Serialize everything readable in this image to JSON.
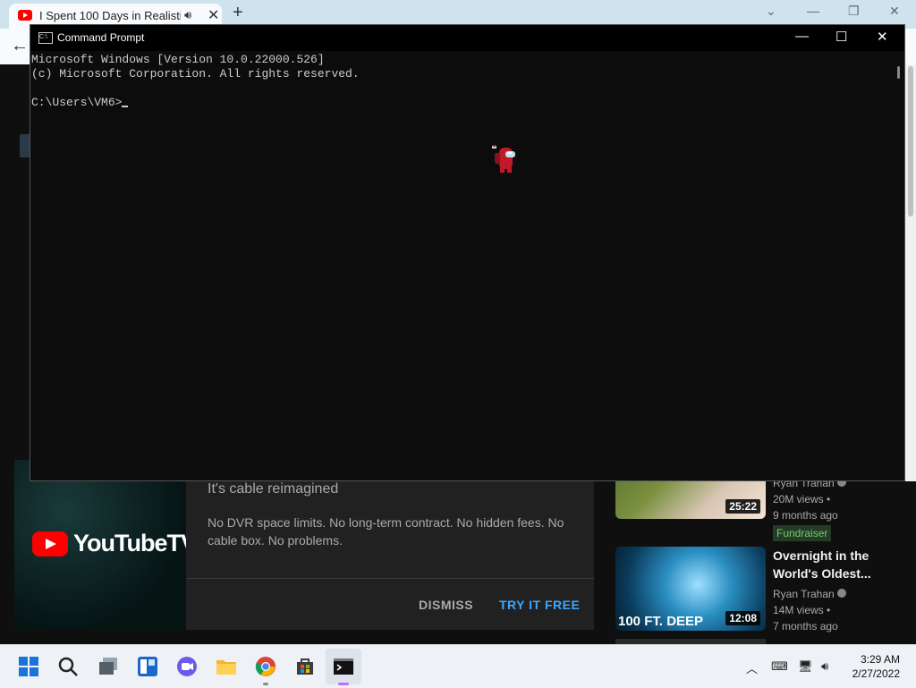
{
  "browser": {
    "tab_title": "I Spent 100 Days in Realistic",
    "new_tab_glyph": "+",
    "window_controls": [
      "⌄",
      "—",
      "❐",
      "✕"
    ]
  },
  "youtube": {
    "ad": {
      "brand": "YouTubeTV",
      "headline": "It's cable reimagined",
      "description": "No DVR space limits. No long-term contract. No hidden fees. No cable box. No problems.",
      "dismiss_label": "DISMISS",
      "try_label": "TRY IT FREE"
    },
    "videos": [
      {
        "title": "",
        "channel": "Ryan Trahan",
        "views": "20M views",
        "age": "9 months ago",
        "duration": "25:22",
        "badge": "Fundraiser"
      },
      {
        "title": "Overnight in the World's Oldest...",
        "channel": "Ryan Trahan",
        "views": "14M views",
        "age": "7 months ago",
        "duration": "12:08",
        "overlay_text": "100 FT. DEEP"
      }
    ]
  },
  "cmd": {
    "title": "Command Prompt",
    "lines": [
      "Microsoft Windows [Version 10.0.22000.526]",
      "(c) Microsoft Corporation. All rights reserved.",
      "",
      "C:\\Users\\VM6>"
    ],
    "buttons": [
      "—",
      "☐",
      "✕"
    ]
  },
  "taskbar": {
    "time": "3:29 AM",
    "date": "2/27/2022",
    "apps": [
      "start-icon",
      "search-icon",
      "task-view-icon",
      "widgets-icon",
      "teams-chat-icon",
      "file-explorer-icon",
      "chrome-icon",
      "store-icon",
      "terminal-icon"
    ]
  },
  "colors": {
    "cmd_bg": "#0c0c0c",
    "yt_bg": "#0f0f0f",
    "accent_blue": "#3ea6ff",
    "taskbar_bg": "#eef2f6"
  }
}
